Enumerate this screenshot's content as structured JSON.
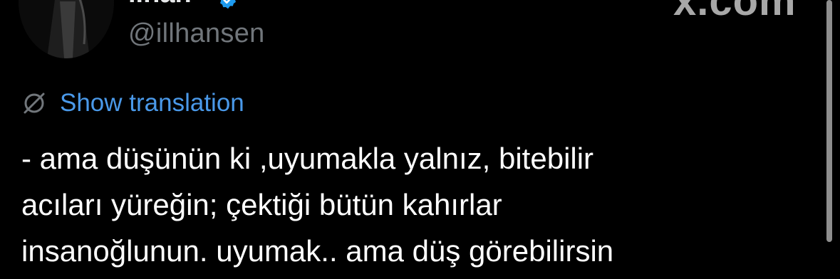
{
  "author": {
    "display_name": "ilhan",
    "handle": "@illhansen",
    "verified": true
  },
  "watermark": {
    "label": "x.com"
  },
  "translation": {
    "label": "Show translation",
    "icon": "globe-slash-icon"
  },
  "tweet": {
    "lines": [
      "- ama düşünün ki ,uyumakla yalnız, bitebilir",
      "acıları yüreğin; çektiği bütün kahırlar",
      "insanoğlunun. uyumak.. ama düş görebilirsin"
    ]
  },
  "colors": {
    "background": "#000000",
    "text": "#ffffff",
    "muted": "#71767b",
    "link": "#4a99e9",
    "verified": "#1d9bf0"
  }
}
